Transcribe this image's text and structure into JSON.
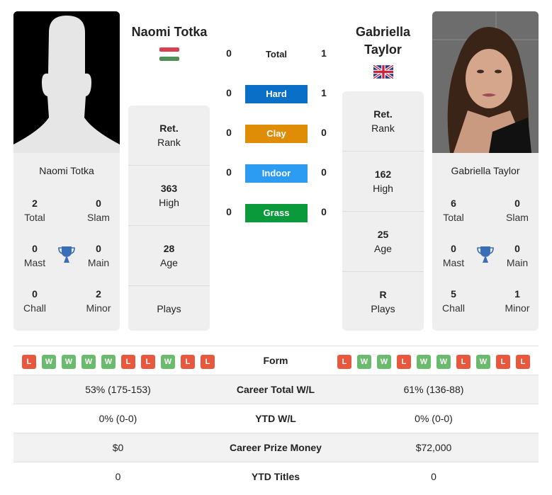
{
  "colors": {
    "hard": "#0a6fc7",
    "clay": "#df8d06",
    "indoor": "#2b9cf2",
    "grass": "#0a9a3c",
    "loss": "#e8583f",
    "win": "#6bbb6f",
    "trophy": "#3a6fb8"
  },
  "player1": {
    "name": "Naomi Totka",
    "flag": "hungary-flag",
    "card_name": "Naomi Totka",
    "titles": {
      "total": {
        "value": "2",
        "label": "Total"
      },
      "slam": {
        "value": "0",
        "label": "Slam"
      },
      "mast": {
        "value": "0",
        "label": "Mast"
      },
      "main": {
        "value": "0",
        "label": "Main"
      },
      "chall": {
        "value": "0",
        "label": "Chall"
      },
      "minor": {
        "value": "2",
        "label": "Minor"
      }
    },
    "info": {
      "rank": {
        "value": "Ret.",
        "label": "Rank"
      },
      "high": {
        "value": "363",
        "label": "High"
      },
      "age": {
        "value": "28",
        "label": "Age"
      },
      "plays": {
        "value": "",
        "label": "Plays"
      }
    },
    "form": [
      "L",
      "W",
      "W",
      "W",
      "W",
      "L",
      "L",
      "W",
      "L",
      "L"
    ]
  },
  "player2": {
    "name_line1": "Gabriella",
    "name_line2": "Taylor",
    "flag": "uk-flag",
    "card_name": "Gabriella Taylor",
    "titles": {
      "total": {
        "value": "6",
        "label": "Total"
      },
      "slam": {
        "value": "0",
        "label": "Slam"
      },
      "mast": {
        "value": "0",
        "label": "Mast"
      },
      "main": {
        "value": "0",
        "label": "Main"
      },
      "chall": {
        "value": "5",
        "label": "Chall"
      },
      "minor": {
        "value": "1",
        "label": "Minor"
      }
    },
    "info": {
      "rank": {
        "value": "Ret.",
        "label": "Rank"
      },
      "high": {
        "value": "162",
        "label": "High"
      },
      "age": {
        "value": "25",
        "label": "Age"
      },
      "plays": {
        "value": "R",
        "label": "Plays"
      }
    },
    "form": [
      "L",
      "W",
      "W",
      "L",
      "W",
      "W",
      "L",
      "W",
      "L",
      "L"
    ]
  },
  "h2h": {
    "total": {
      "label": "Total",
      "p1": "0",
      "p2": "1"
    },
    "hard": {
      "label": "Hard",
      "p1": "0",
      "p2": "1"
    },
    "clay": {
      "label": "Clay",
      "p1": "0",
      "p2": "0"
    },
    "indoor": {
      "label": "Indoor",
      "p1": "0",
      "p2": "0"
    },
    "grass": {
      "label": "Grass",
      "p1": "0",
      "p2": "0"
    }
  },
  "comparison": {
    "form_label": "Form",
    "rows": [
      {
        "label": "Career Total W/L",
        "p1": "53% (175-153)",
        "p2": "61% (136-88)"
      },
      {
        "label": "YTD W/L",
        "p1": "0% (0-0)",
        "p2": "0% (0-0)"
      },
      {
        "label": "Career Prize Money",
        "p1": "$0",
        "p2": "$72,000"
      },
      {
        "label": "YTD Titles",
        "p1": "0",
        "p2": "0"
      }
    ]
  }
}
